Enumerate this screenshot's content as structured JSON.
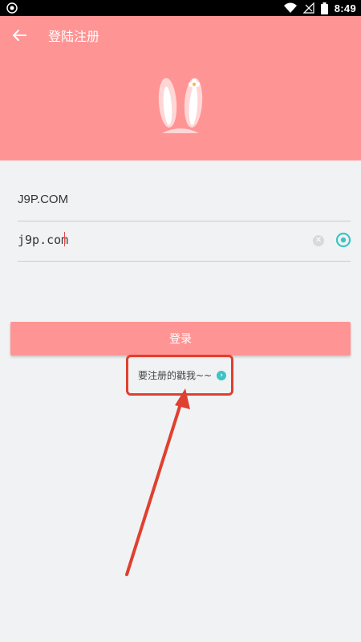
{
  "status_bar": {
    "time": "8:49"
  },
  "header": {
    "title": "登陆注册"
  },
  "form": {
    "account_value": "J9P.COM",
    "password_value": "j9p.com"
  },
  "login_button": {
    "label": "登录"
  },
  "register_link": {
    "label": "要注册的戳我~~"
  },
  "colors": {
    "brand": "#ff9494",
    "accent_teal": "#3cc4c4",
    "annotation_red": "#e0402f",
    "background": "#f1f2f4"
  },
  "icons": [
    "back-arrow-icon",
    "bunny-ears-logo",
    "clear-icon",
    "eye-icon",
    "chevron-right-icon",
    "wifi-icon",
    "signal-icon",
    "battery-icon"
  ]
}
